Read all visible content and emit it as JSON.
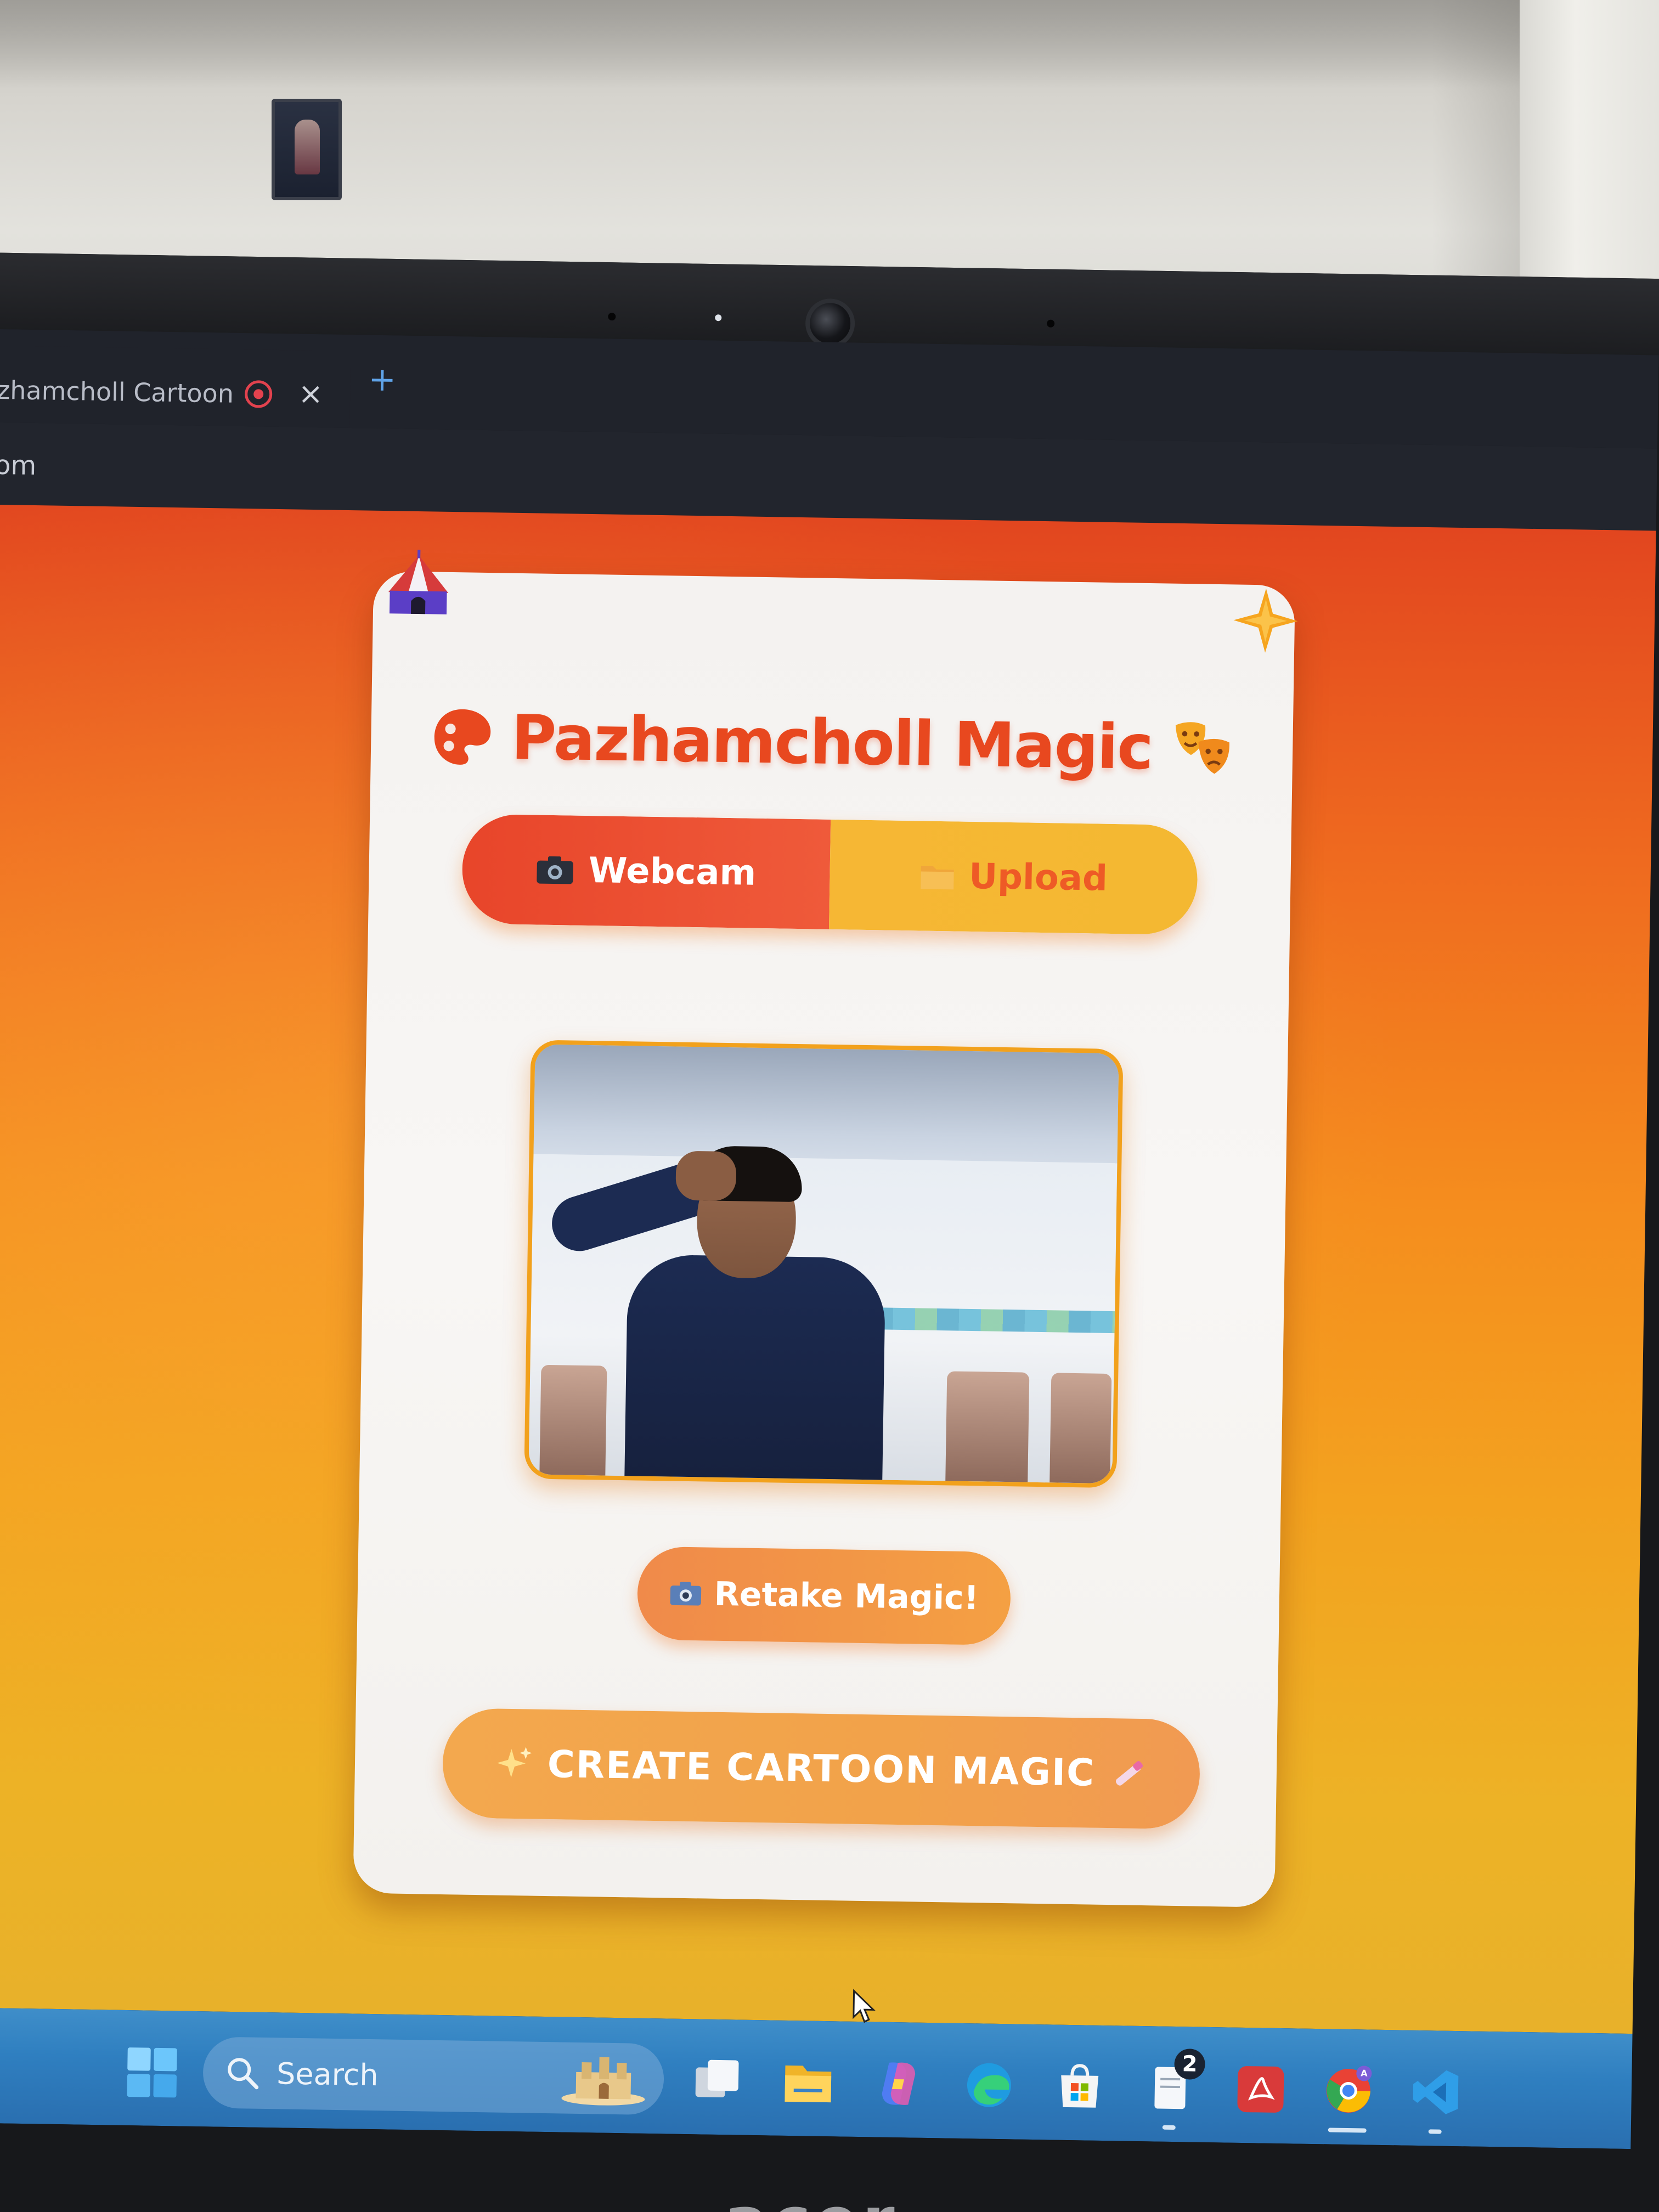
{
  "browser": {
    "tab_title": "zhamcholl Cartoon",
    "tab_close": "×",
    "new_tab": "+",
    "address": "om"
  },
  "app": {
    "title": "Pazhamcholl Magic",
    "mode_tabs": [
      {
        "label": "Webcam",
        "icon": "camera-icon",
        "active": true
      },
      {
        "label": "Upload",
        "icon": "folder-icon",
        "active": false
      }
    ],
    "retake_button": "Retake Magic!",
    "create_button": "CREATE CARTOON MAGIC",
    "colors": {
      "accent_red": "#e8481f",
      "accent_orange": "#f4a043",
      "accent_yellow": "#f6b734",
      "card_bg": "#f6f4f2"
    }
  },
  "taskbar": {
    "search_placeholder": "Search",
    "badge_count": "2",
    "icons": [
      "windows-start-icon",
      "search-icon",
      "task-view-icon",
      "file-explorer-icon",
      "copilot-icon",
      "edge-icon",
      "store-icon",
      "notepad-icon",
      "acrobat-icon",
      "chrome-icon",
      "vscode-icon"
    ]
  },
  "hardware": {
    "brand": "acer"
  }
}
